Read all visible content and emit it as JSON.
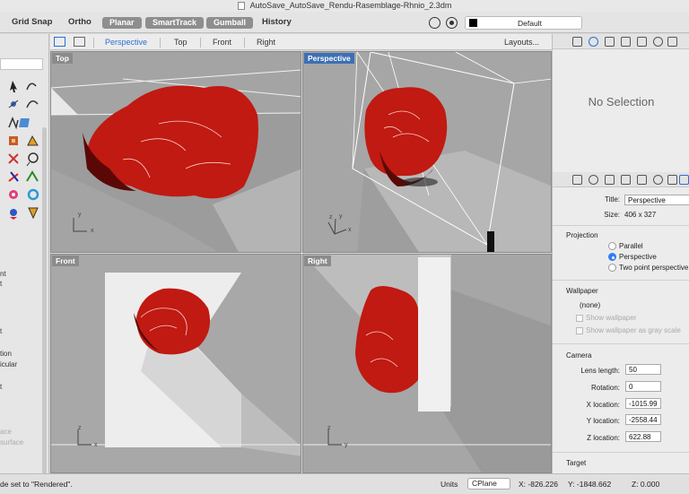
{
  "window": {
    "title": "AutoSave_AutoSave_Rendu-Rasemblage-Rhnio_2.3dm"
  },
  "toolbar": {
    "grid_snap": "Grid Snap",
    "ortho": "Ortho",
    "planar": "Planar",
    "smarttrack": "SmartTrack",
    "gumball": "Gumball",
    "history": "History",
    "layer": "Default"
  },
  "viewport_tabs": {
    "tabs": [
      "Perspective",
      "Top",
      "Front",
      "Right"
    ],
    "active": "Perspective",
    "layouts": "Layouts..."
  },
  "viewports": {
    "top": {
      "label": "Top"
    },
    "perspective": {
      "label": "Perspective"
    },
    "front": {
      "label": "Front"
    },
    "right": {
      "label": "Right"
    }
  },
  "axis": {
    "x": "x",
    "y": "y",
    "z": "z"
  },
  "sidebar": {
    "text_lines": [
      "nt",
      "t",
      "t",
      "tion",
      "icular",
      "t"
    ],
    "muted_lines": [
      "ace",
      "surface"
    ]
  },
  "properties": {
    "no_selection": "No Selection",
    "title_label": "Title:",
    "title_value": "Perspective",
    "size_label": "Size:",
    "size_value": "406 x 327",
    "projection": {
      "heading": "Projection",
      "options": [
        "Parallel",
        "Perspective",
        "Two point perspective"
      ],
      "selected": "Perspective"
    },
    "wallpaper": {
      "heading": "Wallpaper",
      "value": "(none)",
      "show": "Show wallpaper",
      "gray": "Show wallpaper as gray scale"
    },
    "camera": {
      "heading": "Camera",
      "lens_label": "Lens length:",
      "lens_value": "50",
      "rotation_label": "Rotation:",
      "rotation_value": "0",
      "x_label": "X location:",
      "x_value": "-1015.99",
      "y_label": "Y location:",
      "y_value": "-2558.44",
      "z_label": "Z location:",
      "z_value": "622.88"
    },
    "target_heading": "Target"
  },
  "status": {
    "message": "de set to \"Rendered\".",
    "units": "Units",
    "cplane": "CPlane",
    "x": "X: -826.226",
    "y": "Y: -1848.662",
    "z": "Z: 0.000"
  },
  "colors": {
    "rose": "#c01a12",
    "rose_dark": "#6a0a08",
    "accent": "#2a6fd6",
    "viewport_bg": "#a6a6a6"
  }
}
